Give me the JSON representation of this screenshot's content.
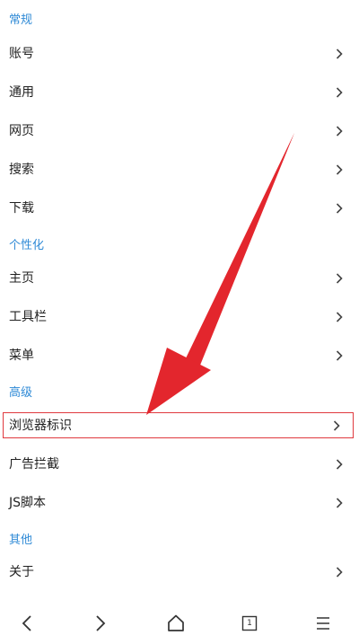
{
  "sections": {
    "general": {
      "title": "常规",
      "items": [
        "账号",
        "通用",
        "网页",
        "搜索",
        "下载"
      ]
    },
    "personalization": {
      "title": "个性化",
      "items": [
        "主页",
        "工具栏",
        "菜单"
      ]
    },
    "advanced": {
      "title": "高级",
      "items": [
        "浏览器标识",
        "广告拦截",
        "JS脚本"
      ]
    },
    "other": {
      "title": "其他",
      "items": [
        "关于"
      ]
    }
  },
  "bottom_bar": {
    "tab_count": "1"
  },
  "colors": {
    "section_header": "#2f8ad6",
    "highlight_border": "#e0393e",
    "annotation_arrow": "#e3262d"
  },
  "icons": [
    "chevron-right-icon",
    "back-icon",
    "forward-icon",
    "home-icon",
    "tabs-icon",
    "menu-icon"
  ]
}
